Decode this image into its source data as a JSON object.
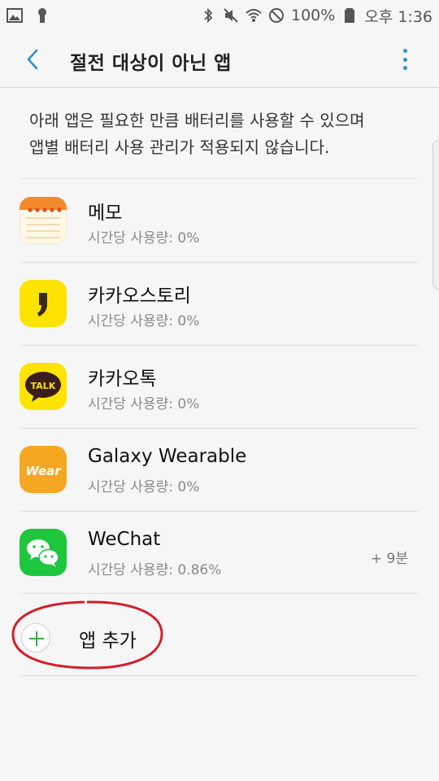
{
  "status_bar": {
    "battery_text": "100%",
    "time_text": "오후 1:36"
  },
  "header": {
    "title": "절전 대상이 아닌 앱"
  },
  "description": {
    "line1": "아래 앱은 필요한 만큼 배터리를 사용할 수 있으며",
    "line2": "앱별 배터리 사용 관리가 적용되지 않습니다."
  },
  "apps": [
    {
      "name": "메모",
      "usage": "시간당 사용량: 0%",
      "icon": "memo-icon",
      "extra": ""
    },
    {
      "name": "카카오스토리",
      "usage": "시간당 사용량: 0%",
      "icon": "kakaostory-icon",
      "extra": ""
    },
    {
      "name": "카카오톡",
      "usage": "시간당 사용량: 0%",
      "icon": "kakaotalk-icon",
      "icon_text": "TALK",
      "extra": ""
    },
    {
      "name": "Galaxy Wearable",
      "usage": "시간당 사용량: 0%",
      "icon": "galaxy-wearable-icon",
      "icon_text": "Wear",
      "extra": ""
    },
    {
      "name": "WeChat",
      "usage": "시간당 사용량: 0.86%",
      "icon": "wechat-icon",
      "extra": "+ 9분"
    }
  ],
  "add_app": {
    "label": "앱 추가"
  },
  "colors": {
    "accent": "#2f8fcf",
    "kakao_yellow": "#fce300",
    "wear_orange": "#f5a623",
    "wechat_green": "#1dc63c",
    "annotation_red": "#d21f2a"
  }
}
